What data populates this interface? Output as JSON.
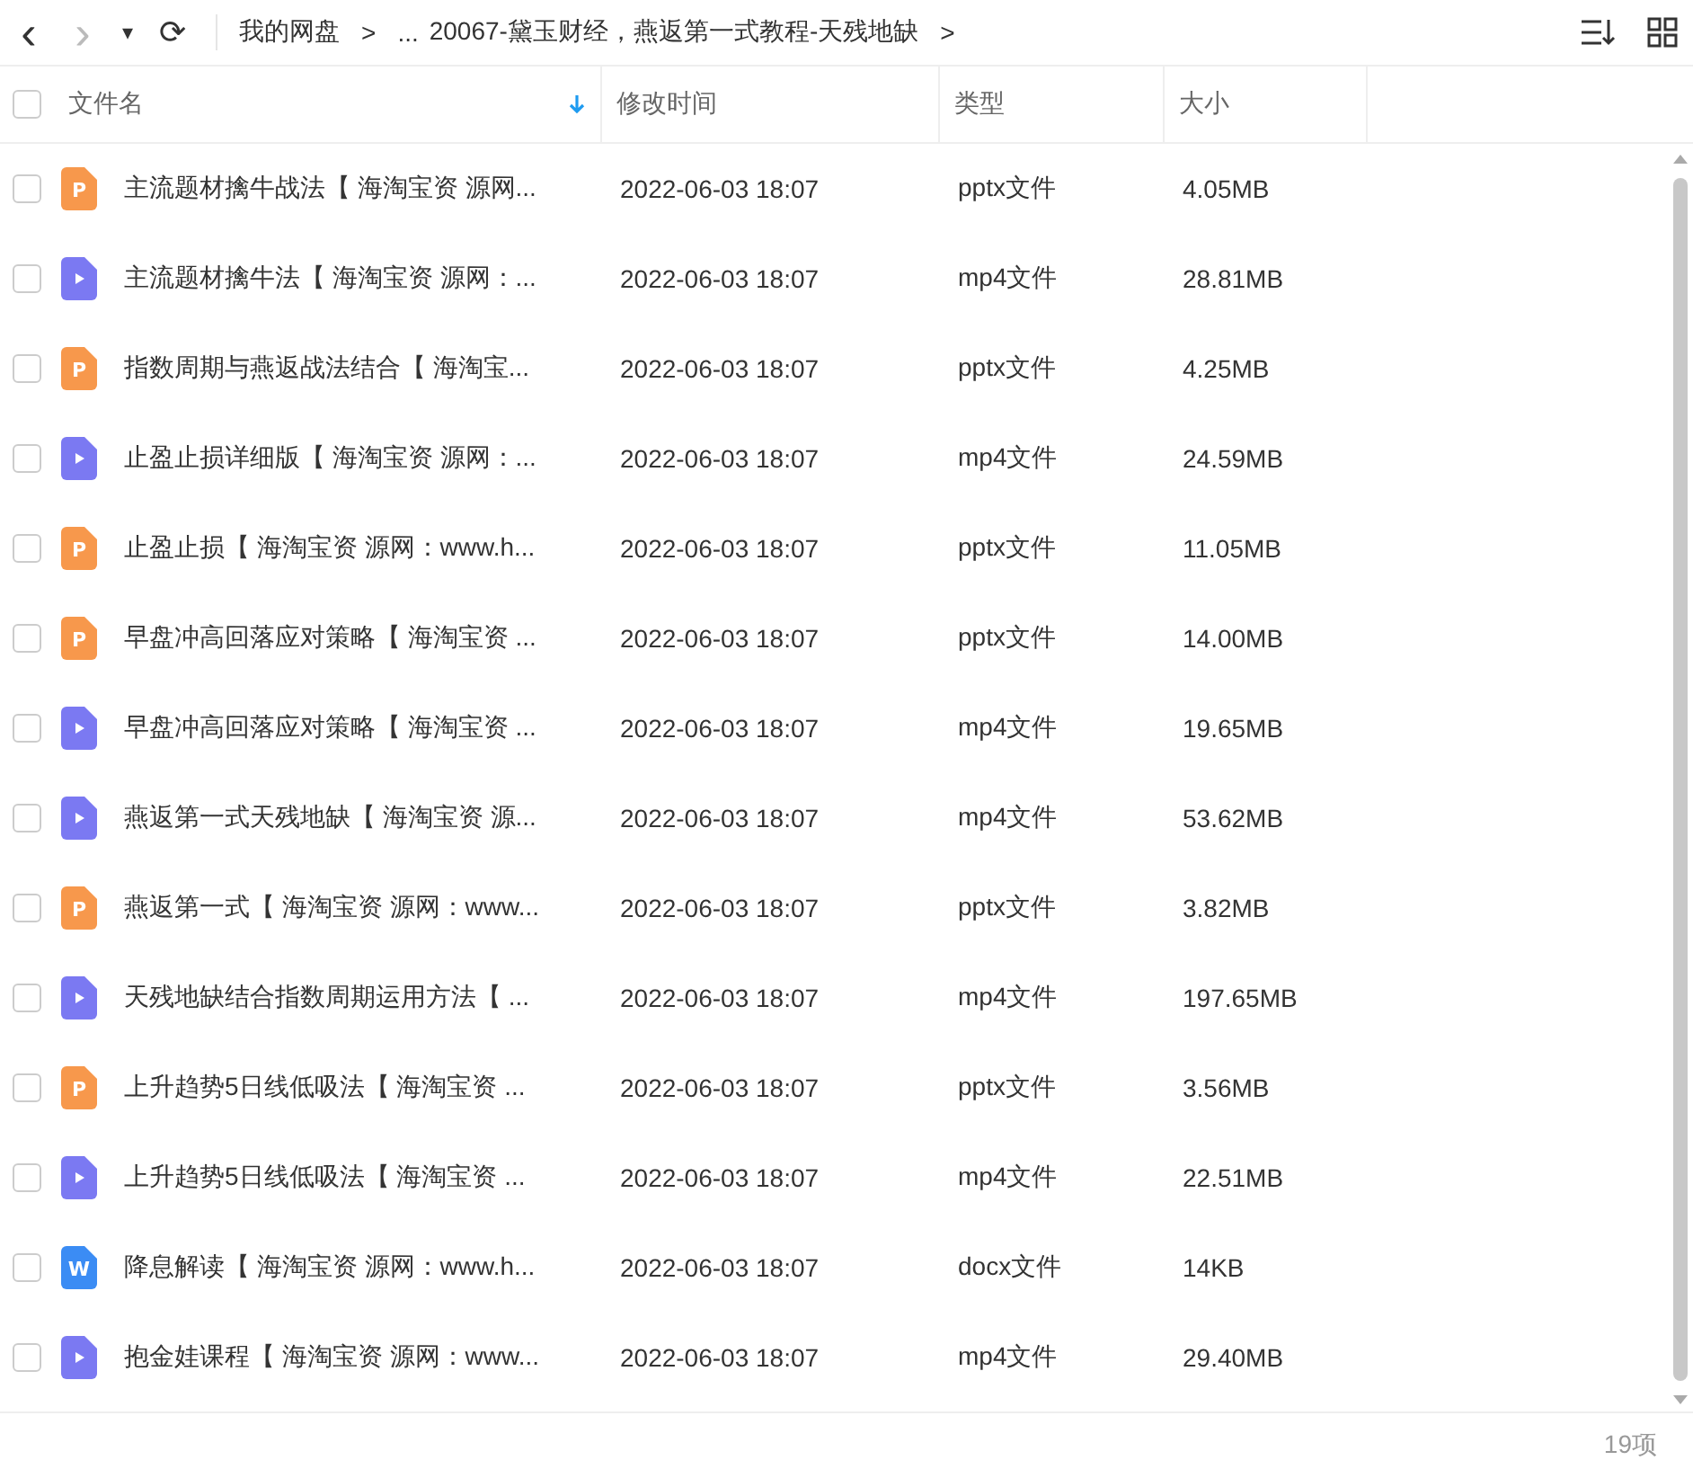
{
  "toolbar": {
    "back": "‹",
    "forward": "›",
    "dropdown": "▾",
    "refresh": "⟳",
    "breadcrumb": [
      {
        "label": "我的网盘"
      },
      {
        "label": "..."
      },
      {
        "label": "20067-黛玉财经，燕返第一式教程-天残地缺"
      }
    ],
    "separator": ">"
  },
  "table": {
    "select_all_checked": false,
    "columns": [
      {
        "label": "文件名",
        "sorted": true
      },
      {
        "label": "修改时间",
        "sorted": false
      },
      {
        "label": "类型",
        "sorted": false
      },
      {
        "label": "大小",
        "sorted": false
      }
    ],
    "rows": [
      {
        "kind": "pptx",
        "icon_label": "P",
        "name": "主流题材擒牛战法【 海淘宝资 源网...",
        "time": "2022-06-03 18:07",
        "type": "pptx文件",
        "size": "4.05MB",
        "checked": false
      },
      {
        "kind": "mp4",
        "name": "主流题材擒牛法【 海淘宝资 源网：...",
        "time": "2022-06-03 18:07",
        "type": "mp4文件",
        "size": "28.81MB",
        "checked": false
      },
      {
        "kind": "pptx",
        "icon_label": "P",
        "name": "指数周期与燕返战法结合【 海淘宝...",
        "time": "2022-06-03 18:07",
        "type": "pptx文件",
        "size": "4.25MB",
        "checked": false
      },
      {
        "kind": "mp4",
        "name": "止盈止损详细版【 海淘宝资 源网：...",
        "time": "2022-06-03 18:07",
        "type": "mp4文件",
        "size": "24.59MB",
        "checked": false
      },
      {
        "kind": "pptx",
        "icon_label": "P",
        "name": "止盈止损【 海淘宝资 源网：www.h...",
        "time": "2022-06-03 18:07",
        "type": "pptx文件",
        "size": "11.05MB",
        "checked": false
      },
      {
        "kind": "pptx",
        "icon_label": "P",
        "name": "早盘冲高回落应对策略【 海淘宝资 ...",
        "time": "2022-06-03 18:07",
        "type": "pptx文件",
        "size": "14.00MB",
        "checked": false
      },
      {
        "kind": "mp4",
        "name": "早盘冲高回落应对策略【 海淘宝资 ...",
        "time": "2022-06-03 18:07",
        "type": "mp4文件",
        "size": "19.65MB",
        "checked": false
      },
      {
        "kind": "mp4",
        "name": "燕返第一式天残地缺【 海淘宝资 源...",
        "time": "2022-06-03 18:07",
        "type": "mp4文件",
        "size": "53.62MB",
        "checked": false
      },
      {
        "kind": "pptx",
        "icon_label": "P",
        "name": "燕返第一式【 海淘宝资 源网：www...",
        "time": "2022-06-03 18:07",
        "type": "pptx文件",
        "size": "3.82MB",
        "checked": false
      },
      {
        "kind": "mp4",
        "name": "天残地缺结合指数周期运用方法【 ...",
        "time": "2022-06-03 18:07",
        "type": "mp4文件",
        "size": "197.65MB",
        "checked": false
      },
      {
        "kind": "pptx",
        "icon_label": "P",
        "name": "上升趋势5日线低吸法【 海淘宝资 ...",
        "time": "2022-06-03 18:07",
        "type": "pptx文件",
        "size": "3.56MB",
        "checked": false
      },
      {
        "kind": "mp4",
        "name": "上升趋势5日线低吸法【 海淘宝资 ...",
        "time": "2022-06-03 18:07",
        "type": "mp4文件",
        "size": "22.51MB",
        "checked": false
      },
      {
        "kind": "docx",
        "icon_label": "W",
        "name": "降息解读【 海淘宝资 源网：www.h...",
        "time": "2022-06-03 18:07",
        "type": "docx文件",
        "size": "14KB",
        "checked": false
      },
      {
        "kind": "mp4",
        "name": "抱金娃课程【 海淘宝资 源网：www...",
        "time": "2022-06-03 18:07",
        "type": "mp4文件",
        "size": "29.40MB",
        "checked": false
      }
    ]
  },
  "status_bar": {
    "count": "19项"
  }
}
